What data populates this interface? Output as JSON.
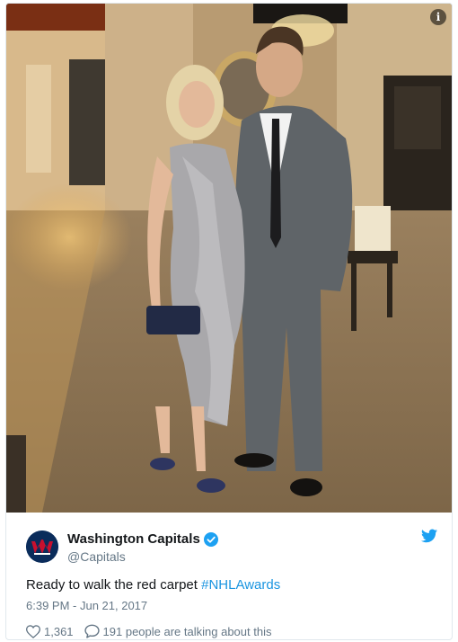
{
  "tweet": {
    "display_name": "Washington Capitals",
    "handle": "@Capitals",
    "text": "Ready to walk the red carpet ",
    "hashtag": "#NHLAwards",
    "timestamp": "6:39 PM - Jun 21, 2017",
    "likes": "1,361",
    "replies_text": "191 people are talking about this"
  },
  "colors": {
    "link": "#1b95e0",
    "text": "#14171a",
    "muted": "#657786",
    "verified": "#1da1f2",
    "brand_navy": "#0a2c5b",
    "brand_red": "#c8102e"
  },
  "icons": {
    "info": "info-icon",
    "verified": "verified-badge-icon",
    "twitter": "twitter-bird-icon",
    "like": "heart-icon",
    "reply": "speech-bubble-icon"
  }
}
